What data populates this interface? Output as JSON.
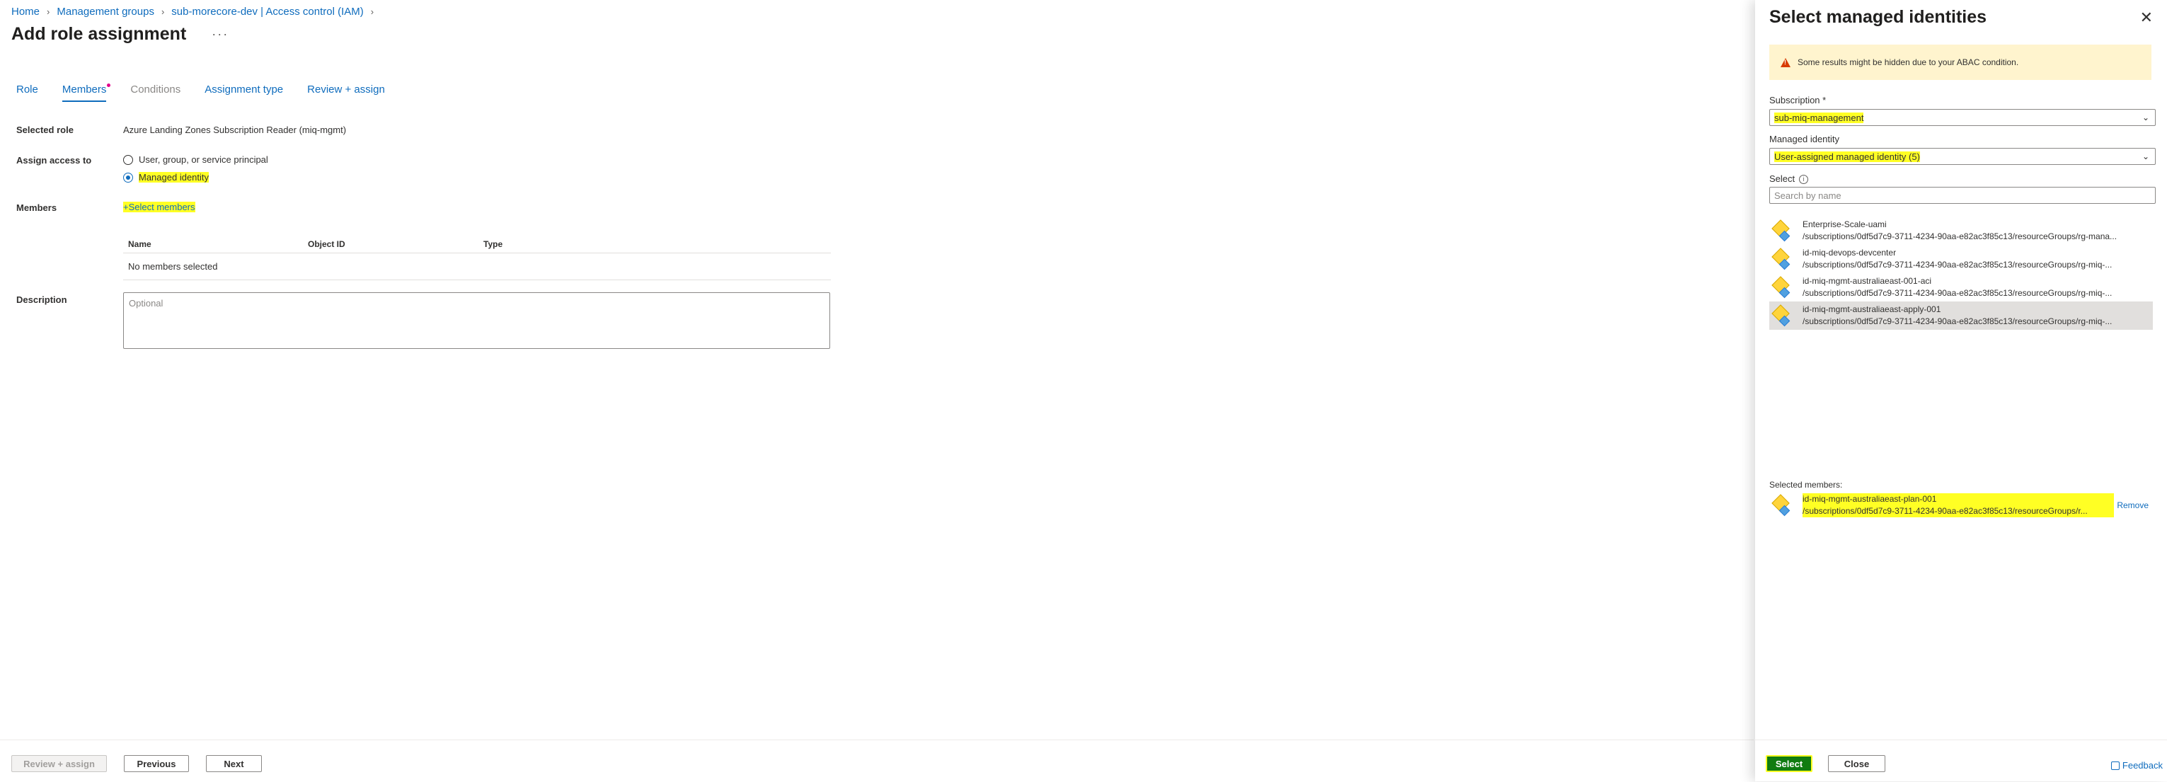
{
  "breadcrumb": [
    "Home",
    "Management groups",
    "sub-morecore-dev | Access control (IAM)"
  ],
  "page": {
    "title": "Add role assignment",
    "more": "···"
  },
  "tabs": [
    {
      "label": "Role",
      "state": "link"
    },
    {
      "label": "Members",
      "state": "active"
    },
    {
      "label": "Conditions",
      "state": "disabled"
    },
    {
      "label": "Assignment type",
      "state": "link"
    },
    {
      "label": "Review + assign",
      "state": "link"
    }
  ],
  "form": {
    "selected_role_label": "Selected role",
    "selected_role_value": "Azure Landing Zones Subscription Reader (miq-mgmt)",
    "assign_access_label": "Assign access to",
    "option_user": "User, group, or service principal",
    "option_managed": "Managed identity",
    "members_label": "Members",
    "select_members": "Select members",
    "table_headers": [
      "Name",
      "Object ID",
      "Type"
    ],
    "no_members": "No members selected",
    "description_label": "Description",
    "description_placeholder": "Optional"
  },
  "footer": {
    "review": "Review + assign",
    "previous": "Previous",
    "next": "Next"
  },
  "panel": {
    "title": "Select managed identities",
    "close": "✕",
    "warning": "Some results might be hidden due to your ABAC condition.",
    "subscription_label": "Subscription *",
    "subscription_value": "sub-miq-management",
    "managed_identity_label": "Managed identity",
    "managed_identity_value": "User-assigned managed identity (5)",
    "select_label": "Select",
    "search_placeholder": "Search by name",
    "identities": [
      {
        "name": "Enterprise-Scale-uami",
        "path": "/subscriptions/0df5d7c9-3711-4234-90aa-e82ac3f85c13/resourceGroups/rg-mana..."
      },
      {
        "name": "id-miq-devops-devcenter",
        "path": "/subscriptions/0df5d7c9-3711-4234-90aa-e82ac3f85c13/resourceGroups/rg-miq-..."
      },
      {
        "name": "id-miq-mgmt-australiaeast-001-aci",
        "path": "/subscriptions/0df5d7c9-3711-4234-90aa-e82ac3f85c13/resourceGroups/rg-miq-..."
      },
      {
        "name": "id-miq-mgmt-australiaeast-apply-001",
        "path": "/subscriptions/0df5d7c9-3711-4234-90aa-e82ac3f85c13/resourceGroups/rg-miq-..."
      }
    ],
    "selected_label": "Selected members:",
    "selected": {
      "name": "id-miq-mgmt-australiaeast-plan-001",
      "path": "/subscriptions/0df5d7c9-3711-4234-90aa-e82ac3f85c13/resourceGroups/r..."
    },
    "remove": "Remove",
    "select_button": "Select",
    "close_button": "Close",
    "feedback": "Feedback"
  },
  "colors": {
    "accent": "#0f6cbd",
    "highlight": "#ffff24",
    "warning_bg": "#fff4ce",
    "select_button": "#107c10"
  }
}
